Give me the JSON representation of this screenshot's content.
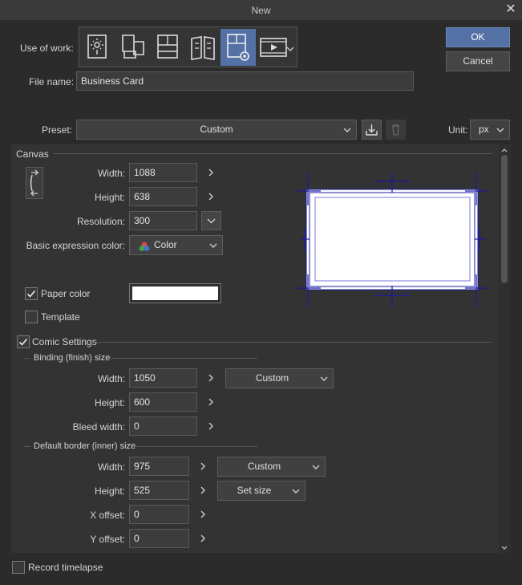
{
  "window": {
    "title": "New"
  },
  "top": {
    "use_of_work_label": "Use of work:",
    "file_name_label": "File name:",
    "file_name_value": "Business Card",
    "ok_label": "OK",
    "cancel_label": "Cancel",
    "preset_label": "Preset:",
    "preset_value": "Custom",
    "unit_label": "Unit:",
    "unit_value": "px"
  },
  "canvas": {
    "section_label": "Canvas",
    "width_label": "Width:",
    "width_value": "1088",
    "height_label": "Height:",
    "height_value": "638",
    "resolution_label": "Resolution:",
    "resolution_value": "300",
    "color_label": "Basic expression color:",
    "color_value": "Color",
    "paper_color_label": "Paper color",
    "template_label": "Template",
    "paper_color_hex": "#ffffff"
  },
  "comic": {
    "label": "Comic Settings",
    "binding_label": "Binding (finish) size",
    "b_width_label": "Width:",
    "b_width_value": "1050",
    "b_width_preset": "Custom",
    "b_height_label": "Height:",
    "b_height_value": "600",
    "bleed_label": "Bleed width:",
    "bleed_value": "0",
    "border_label": "Default border (inner) size",
    "d_width_label": "Width:",
    "d_width_value": "975",
    "d_width_preset": "Custom",
    "d_height_label": "Height:",
    "d_height_value": "525",
    "d_height_preset": "Set size",
    "x_offset_label": "X offset:",
    "x_offset_value": "0",
    "y_offset_label": "Y offset:",
    "y_offset_value": "0"
  },
  "footer": {
    "timelapse_label": "Record timelapse"
  },
  "colors": {
    "accent": "#5471a6",
    "guide": "#1a1aa0",
    "background": "#2b2b2b"
  }
}
